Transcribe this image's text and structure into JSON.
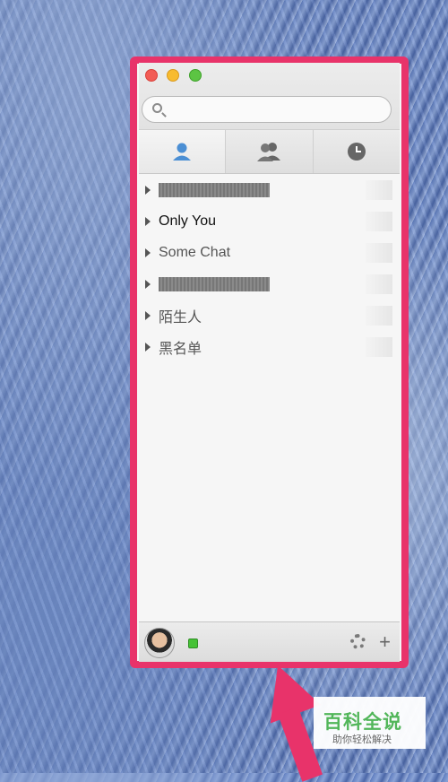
{
  "window": {
    "search": {
      "placeholder": ""
    },
    "tabs": [
      {
        "name": "contacts",
        "icon": "person-icon",
        "active": true
      },
      {
        "name": "groups",
        "icon": "group-icon",
        "active": false
      },
      {
        "name": "recent",
        "icon": "clock-icon",
        "active": false
      }
    ],
    "groups": [
      {
        "label": ""
      },
      {
        "label": "Only You"
      },
      {
        "label": "Some Chat"
      },
      {
        "label": ""
      },
      {
        "label": "陌生人"
      },
      {
        "label": "黑名单"
      }
    ],
    "bottom": {
      "avatar": "avatar",
      "status_color": "#46c236",
      "settings_icon": "gear-icon",
      "add_icon": "plus-icon",
      "add_label": "+"
    }
  },
  "watermark": {
    "title": "百科全说",
    "subtitle": "助你轻松解决"
  },
  "colors": {
    "highlight": "#e8336a",
    "watermark_green": "#52b65a"
  }
}
